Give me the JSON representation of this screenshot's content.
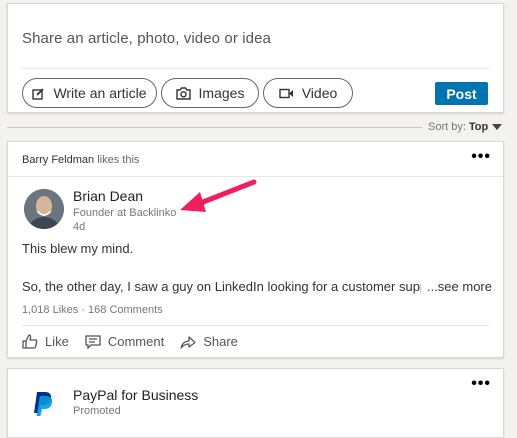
{
  "share_box": {
    "prompt": "Share an article, photo, video or idea",
    "actions": [
      {
        "label": "Write an article",
        "icon": "pencil-icon"
      },
      {
        "label": "Images",
        "icon": "camera-icon"
      },
      {
        "label": "Video",
        "icon": "video-icon"
      }
    ],
    "post_label": "Post",
    "post_color": "#0073b1"
  },
  "sort": {
    "prefix": "Sort by:",
    "value": "Top"
  },
  "post": {
    "liker": "Barry Feldman",
    "liker_suffix": "likes this",
    "author": {
      "name": "Brian Dean",
      "title": "Founder at Backlinko",
      "time": "4d"
    },
    "annotation_arrow_color": "#ee1f5a",
    "text_line1": "This blew my mind.",
    "text_line2": "So, the other day, I saw a guy on LinkedIn looking for a customer support person...",
    "see_more": "...see more",
    "counts": "1,018 Likes · 168 Comments",
    "actions": [
      {
        "label": "Like",
        "icon": "thumbs-up-icon"
      },
      {
        "label": "Comment",
        "icon": "comment-icon"
      },
      {
        "label": "Share",
        "icon": "share-icon"
      }
    ]
  },
  "ad": {
    "name": "PayPal for Business",
    "label": "Promoted",
    "logo_colors": [
      "#003087",
      "#009cde"
    ]
  }
}
